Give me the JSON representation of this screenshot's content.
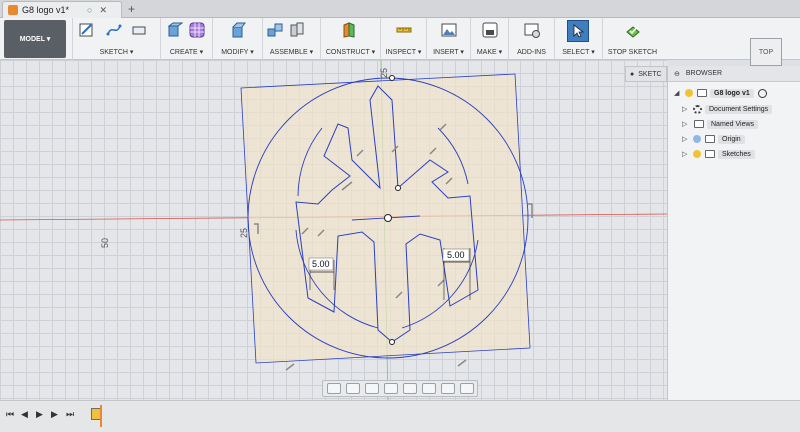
{
  "document_tab": {
    "title": "G8 logo v1*",
    "new_tab": "+"
  },
  "toolbar": {
    "model_label": "MODEL ▾",
    "groups": {
      "sketch": "SKETCH ▾",
      "create": "CREATE ▾",
      "modify": "MODIFY ▾",
      "assemble": "ASSEMBLE ▾",
      "construct": "CONSTRUCT ▾",
      "inspect": "INSPECT ▾",
      "insert": "INSERT ▾",
      "make": "MAKE ▾",
      "addins": "ADD-INS",
      "select": "SELECT ▾",
      "stop_sketch": "STOP SKETCH"
    }
  },
  "viewcube": {
    "label": "TOP"
  },
  "sketch_panel": {
    "label": "SKETC"
  },
  "browser": {
    "header": "BROWSER",
    "items": [
      {
        "label": "G8 logo v1"
      },
      {
        "label": "Document Settings"
      },
      {
        "label": "Named Views"
      },
      {
        "label": "Origin"
      },
      {
        "label": "Sketches"
      }
    ]
  },
  "sketch": {
    "dim_left": "5.00",
    "dim_right": "5.00",
    "axis_label_25_top": "25",
    "axis_label_25_left": "25",
    "axis_label_50": "50"
  },
  "colors": {
    "sketch_line": "#2a3fbf",
    "profile_fill": "#f2e2c9",
    "x_axis": "#d9534f",
    "y_axis": "#7ac16b"
  }
}
